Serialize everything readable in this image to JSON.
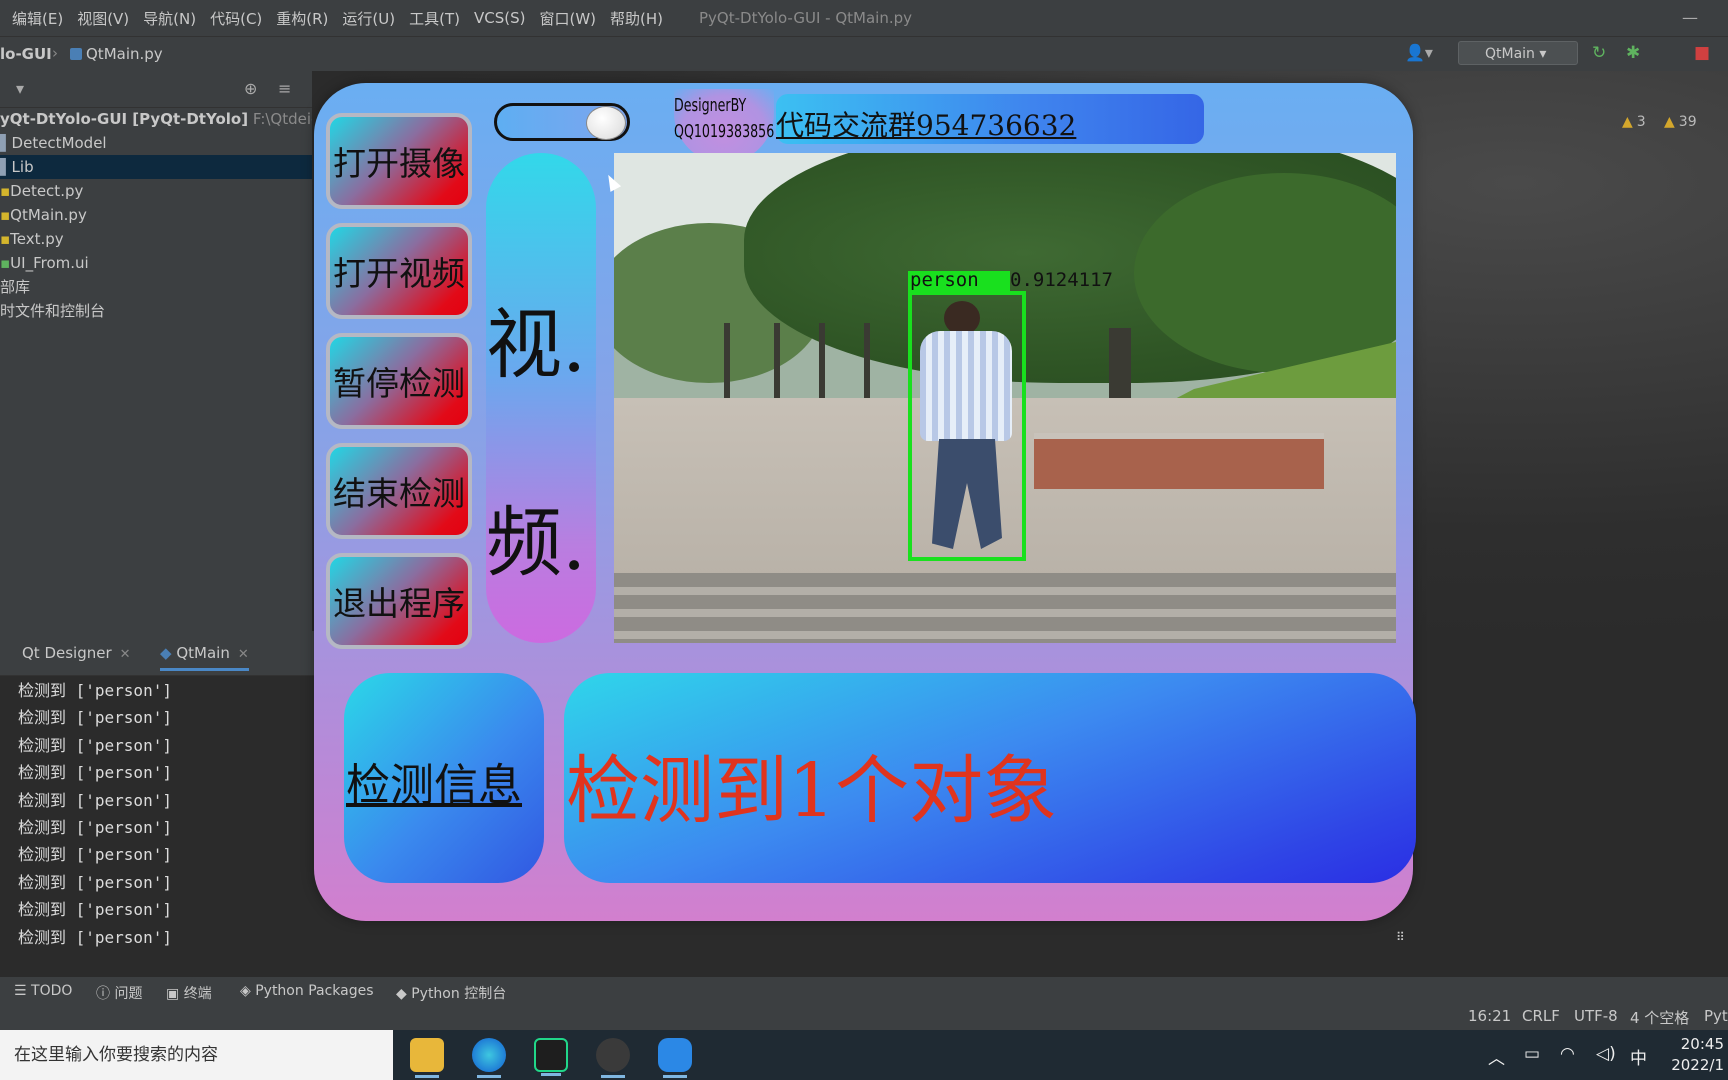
{
  "ide": {
    "menu": [
      "编辑(E)",
      "视图(V)",
      "导航(N)",
      "代码(C)",
      "重构(R)",
      "运行(U)",
      "工具(T)",
      "VCS(S)",
      "窗口(W)",
      "帮助(H)"
    ],
    "window_title": "PyQt-DtYolo-GUI - QtMain.py",
    "breadcrumb_project": "lo-GUI",
    "breadcrumb_file": "QtMain.py",
    "run_config": "QtMain",
    "project_tree": {
      "root_name": "yQt-DtYolo-GUI [PyQt-DtYolo]",
      "root_path": "F:\\Qtdeigne",
      "items": [
        "DetectModel",
        "Lib",
        "Detect.py",
        "QtMain.py",
        "Text.py",
        "UI_From.ui",
        "部库",
        "时文件和控制台"
      ]
    },
    "warnings": {
      "count_a": "3",
      "count_b": "39"
    },
    "run_tabs": [
      "Qt Designer",
      "QtMain"
    ],
    "console_lines": [
      "检测到 ['person']",
      "检测到 ['person']",
      "检测到 ['person']",
      "检测到 ['person']",
      "检测到 ['person']",
      "检测到 ['person']",
      "检测到 ['person']",
      "检测到 ['person']",
      "检测到 ['person']",
      "检测到 ['person']"
    ],
    "tool_tabs": [
      "TODO",
      "问题",
      "终端",
      "Python Packages",
      "Python 控制台"
    ],
    "status": {
      "position": "16:21",
      "line_sep": "CRLF",
      "encoding": "UTF-8",
      "indent": "4 个空格",
      "interpreter": "Pyt"
    }
  },
  "taskbar": {
    "search_placeholder": "在这里输入你要搜索的内容",
    "ime": "中",
    "time": "20:45",
    "date": "2022/1"
  },
  "app": {
    "buttons": {
      "open_camera": "打开摄像",
      "open_video": "打开视频",
      "pause_detect": "暂停检测",
      "stop_detect": "结束检测",
      "exit_app": "退出程序"
    },
    "designer_line1": "DesignerBY",
    "designer_line2": "QQ1019383856",
    "group_banner": "代码交流群954736632",
    "video_label_1": "视.",
    "video_label_2": "频.",
    "detection": {
      "class": "person",
      "confidence": "0.9124117"
    },
    "info_title": "检测信息",
    "result_text": "检测到1个对象",
    "toggle_on": true
  }
}
